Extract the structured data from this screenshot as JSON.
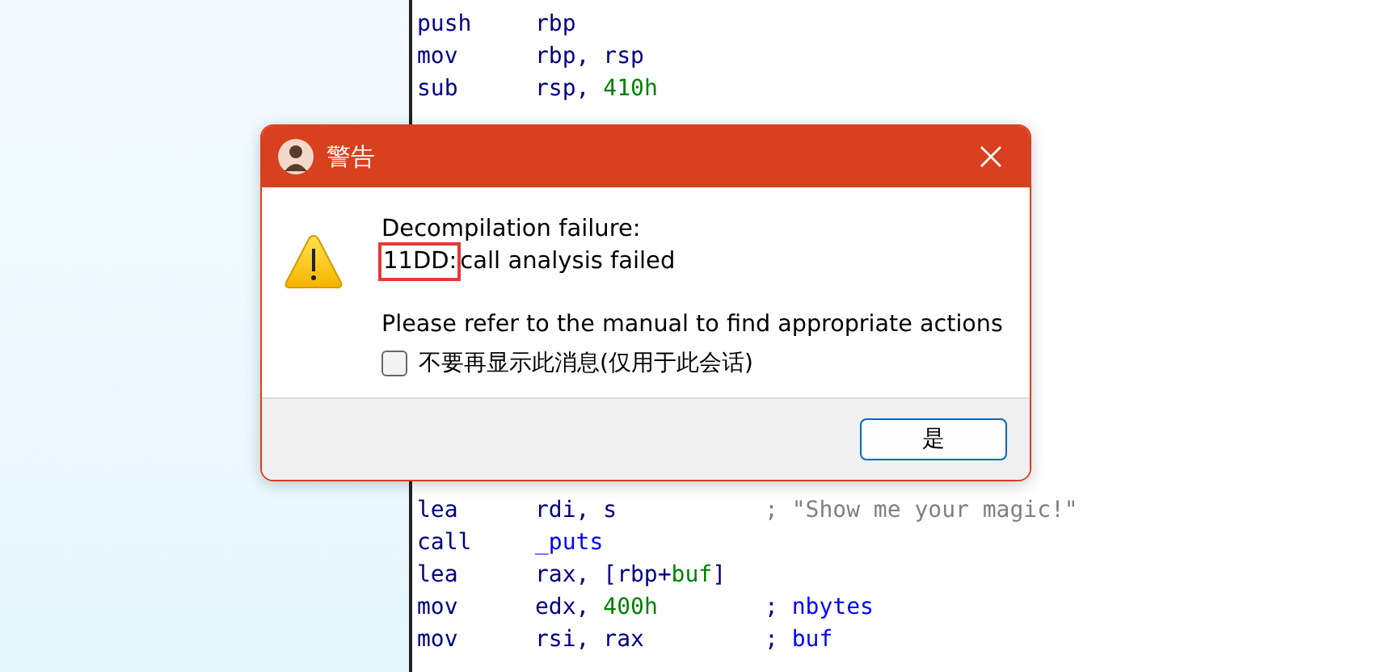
{
  "code_top": [
    {
      "mnemonic": "push",
      "operands": [
        {
          "kind": "plain",
          "text": "rbp"
        }
      ]
    },
    {
      "mnemonic": "mov",
      "operands": [
        {
          "kind": "plain",
          "text": "rbp, rsp"
        }
      ]
    },
    {
      "mnemonic": "sub",
      "operands": [
        {
          "kind": "plain",
          "text": "rsp, "
        },
        {
          "kind": "number",
          "text": "410h"
        }
      ]
    }
  ],
  "code_bottom": [
    {
      "mnemonic": "lea",
      "operands": [
        {
          "kind": "plain",
          "text": "rdi, s"
        }
      ],
      "comment": [
        {
          "kind": "string",
          "text": "; \"Show me your magic!\""
        }
      ]
    },
    {
      "mnemonic": "call",
      "operands": [
        {
          "kind": "symbol",
          "text": "_puts"
        }
      ]
    },
    {
      "mnemonic": "lea",
      "operands": [
        {
          "kind": "plain",
          "text": "rax, [rbp+"
        },
        {
          "kind": "number",
          "text": "buf"
        },
        {
          "kind": "plain",
          "text": "]"
        }
      ]
    },
    {
      "mnemonic": "mov",
      "operands": [
        {
          "kind": "plain",
          "text": "edx, "
        },
        {
          "kind": "number",
          "text": "400h"
        }
      ],
      "comment": [
        {
          "kind": "plain",
          "text": "; "
        },
        {
          "kind": "symbol",
          "text": "nbytes"
        }
      ]
    },
    {
      "mnemonic": "mov",
      "operands": [
        {
          "kind": "plain",
          "text": "rsi, rax"
        }
      ],
      "comment": [
        {
          "kind": "plain",
          "text": "; "
        },
        {
          "kind": "symbol",
          "text": "buf"
        }
      ]
    }
  ],
  "dialog": {
    "title": "警告",
    "heading": "Decompilation failure:",
    "error_code": {
      "text": "11DD:",
      "highlighted": true
    },
    "error_text": "call analysis failed",
    "hint": "Please refer to the manual to find appropriate actions",
    "checkbox": {
      "label": "不要再显示此消息(仅用于此会话)",
      "checked": false
    },
    "buttons": [
      {
        "label": "是",
        "default": true
      }
    ]
  }
}
